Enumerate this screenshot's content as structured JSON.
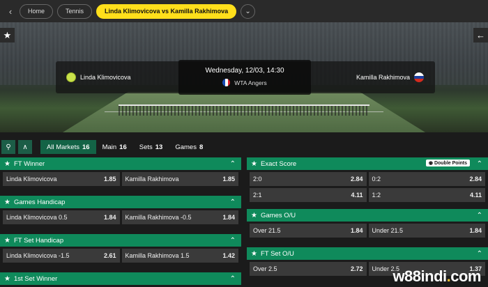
{
  "breadcrumb": {
    "items": [
      "Home",
      "Tennis"
    ],
    "active": "Linda Klimovicova vs Kamilla Rakhimova"
  },
  "hero": {
    "player1": "Linda Klimovicova",
    "player2": "Kamilla Rakhimova",
    "date": "Wednesday, 12/03, 14:30",
    "tournament": "WTA Angers"
  },
  "filters": {
    "tabs": [
      {
        "label": "All Markets",
        "count": "16"
      },
      {
        "label": "Main",
        "count": "16"
      },
      {
        "label": "Sets",
        "count": "13"
      },
      {
        "label": "Games",
        "count": "8"
      }
    ]
  },
  "left_markets": {
    "ft_winner": {
      "title": "FT Winner",
      "sel": [
        {
          "name": "Linda Klimovicova",
          "odds": "1.85"
        },
        {
          "name": "Kamilla Rakhimova",
          "odds": "1.85"
        }
      ]
    },
    "games_handicap": {
      "title": "Games Handicap",
      "sel": [
        {
          "name": "Linda Klimovicova  0.5",
          "odds": "1.84"
        },
        {
          "name": "Kamilla Rakhimova  -0.5",
          "odds": "1.84"
        }
      ]
    },
    "ft_set_handicap": {
      "title": "FT Set Handicap",
      "sel": [
        {
          "name": "Linda Klimovicova  -1.5",
          "odds": "2.61"
        },
        {
          "name": "Kamilla Rakhimova  1.5",
          "odds": "1.42"
        }
      ]
    },
    "first_set_winner": {
      "title": "1st Set Winner"
    }
  },
  "right_markets": {
    "exact_score": {
      "title": "Exact Score",
      "badge": "Double Points",
      "sel": [
        {
          "name": "2:0",
          "odds": "2.84"
        },
        {
          "name": "0:2",
          "odds": "2.84"
        },
        {
          "name": "2:1",
          "odds": "4.11"
        },
        {
          "name": "1:2",
          "odds": "4.11"
        }
      ]
    },
    "games_ou": {
      "title": "Games O/U",
      "sel": [
        {
          "name": "Over 21.5",
          "odds": "1.84"
        },
        {
          "name": "Under 21.5",
          "odds": "1.84"
        }
      ]
    },
    "ft_set_ou": {
      "title": "FT Set O/U",
      "sel": [
        {
          "name": "Over 2.5",
          "odds": "2.72"
        },
        {
          "name": "Under 2.5",
          "odds": "1.37"
        }
      ]
    }
  },
  "watermark": {
    "main": "w88indi",
    "dot": ".",
    "tld": "com"
  },
  "colors": {
    "accent": "#ffdf1b",
    "market_header": "#0f8a5b",
    "tab_active": "#136346"
  }
}
